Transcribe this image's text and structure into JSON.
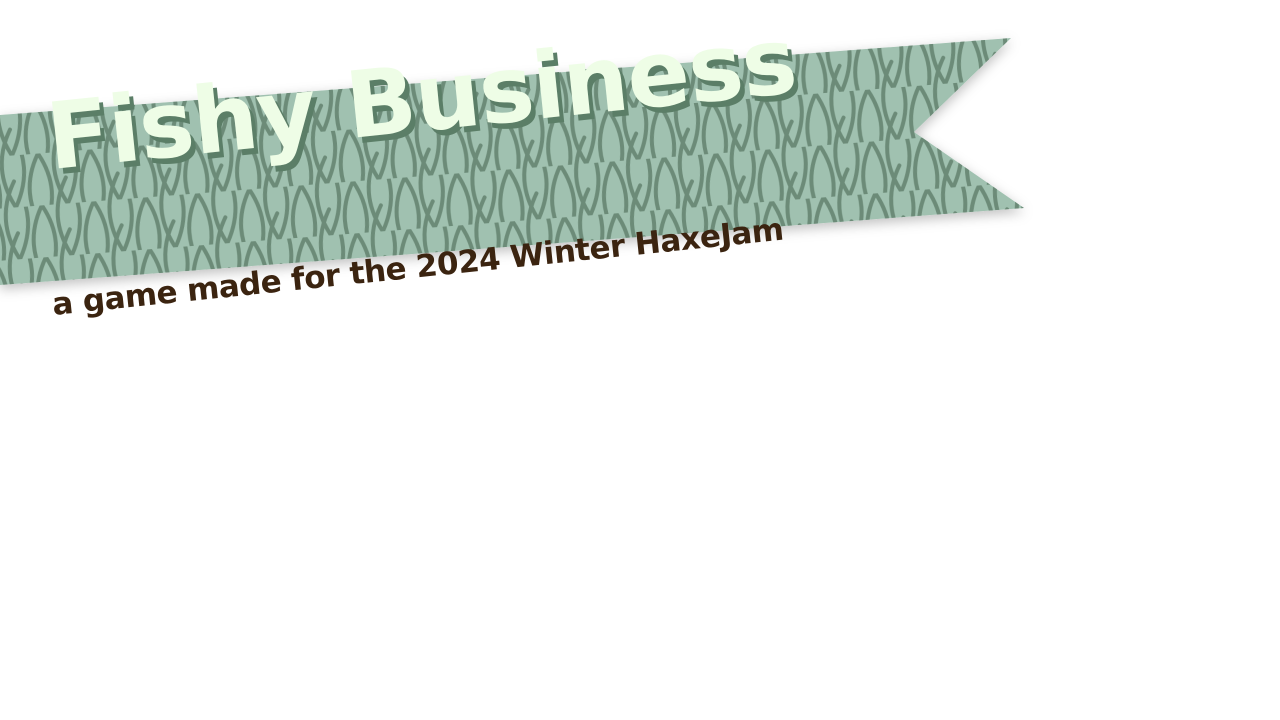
{
  "screen": {
    "title": "Fishy Business",
    "subtitle": "a game made for the 2024 Winter HaxeJam"
  },
  "icons": {
    "banner": "fish-scale-ribbon-banner"
  },
  "colors": {
    "background": "#ffffff",
    "banner_fill": "#a0c1b0",
    "scale_outline": "#6c8b78",
    "title_text": "#eefde6",
    "title_shadow": "#5b7e67",
    "subtitle_text": "#3b2410"
  }
}
